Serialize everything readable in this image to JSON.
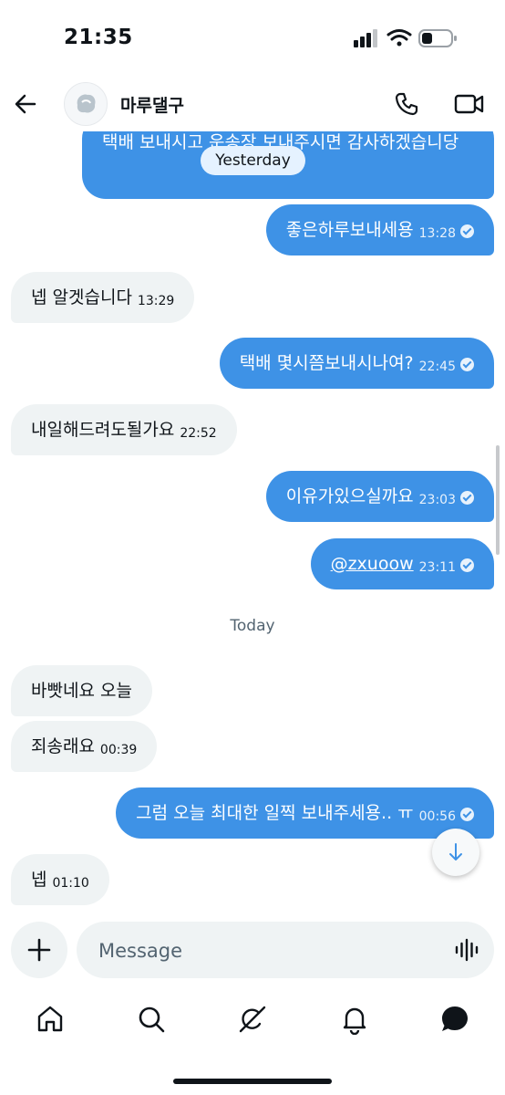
{
  "status_bar": {
    "time": "21:35"
  },
  "header": {
    "contact_name": "마루댈구"
  },
  "messages": [
    {
      "dir": "out",
      "text": "택배 보내시고 운송장 보내주시면 감사하겠습니당",
      "time": ""
    },
    {
      "dir": "out",
      "text": "좋은하루보내세용",
      "time": "13:28"
    },
    {
      "dir": "in",
      "text": "넵 알겟습니다",
      "time": "13:29"
    },
    {
      "dir": "out",
      "text": "택배 몇시쯤보내시나여?",
      "time": "22:45"
    },
    {
      "dir": "in",
      "text": "내일해드려도될가요",
      "time": "22:52"
    },
    {
      "dir": "out",
      "text": "이유가있으실까요",
      "time": "23:03"
    },
    {
      "dir": "out",
      "text": "@zxuoow",
      "time": "23:11"
    },
    {
      "dir": "in",
      "text": "바빳네요 오늘",
      "time": ""
    },
    {
      "dir": "in",
      "text": "죄송래요",
      "time": "00:39"
    },
    {
      "dir": "out",
      "text": "그럼 오늘 최대한 일찍 보내주세용.. ㅠ",
      "time": "00:56"
    },
    {
      "dir": "in",
      "text": "넵",
      "time": "01:10"
    }
  ],
  "date_separators": {
    "yesterday": "Yesterday",
    "today": "Today"
  },
  "composer": {
    "placeholder": "Message"
  },
  "nav": [
    "home-icon",
    "search-icon",
    "grok-icon",
    "notifications-icon",
    "messages-icon"
  ],
  "colors": {
    "outgoing_bubble": "#3e92e6",
    "incoming_bubble": "#eff3f4"
  }
}
